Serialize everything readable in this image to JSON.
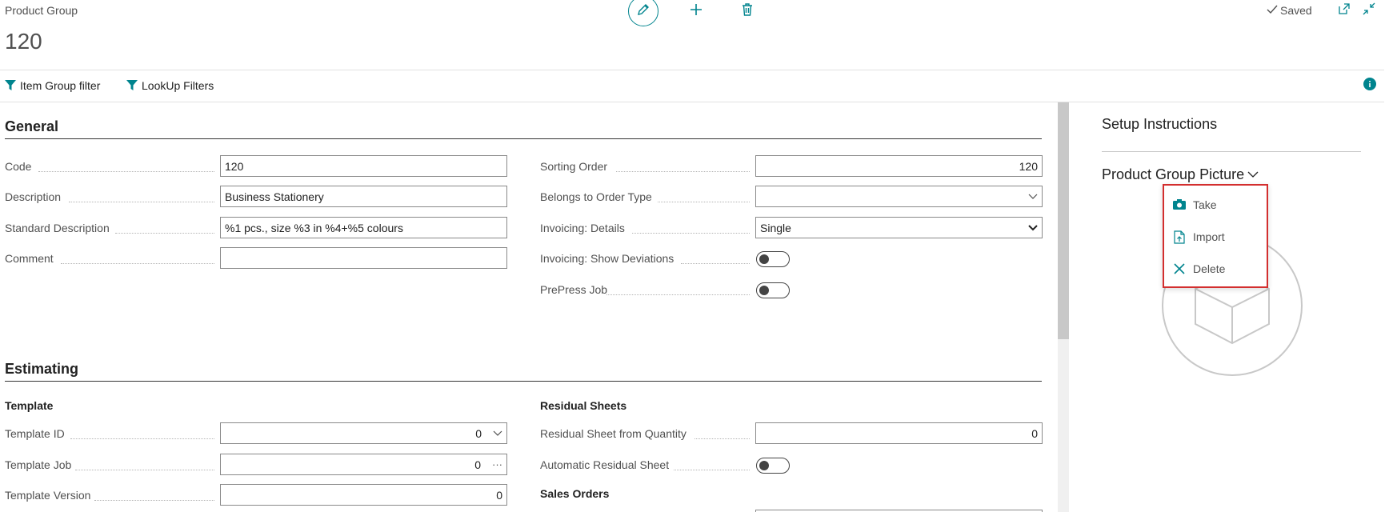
{
  "header": {
    "page_caption": "Product Group",
    "record_title": "120",
    "saved_label": "Saved",
    "icons": [
      "edit-icon",
      "plus-icon",
      "delete-icon",
      "open-new-window-icon",
      "collapse-icon",
      "checkmark-icon"
    ]
  },
  "actions": {
    "item_group_filter": "Item Group filter",
    "lookup_filters": "LookUp Filters"
  },
  "general": {
    "title": "General",
    "code_label": "Code",
    "code_value": "120",
    "description_label": "Description",
    "description_value": "Business Stationery",
    "std_description_label": "Standard Description",
    "std_description_value": "%1 pcs., size %3 in %4+%5 colours",
    "comment_label": "Comment",
    "comment_value": "",
    "sorting_order_label": "Sorting Order",
    "sorting_order_value": "120",
    "belongs_label": "Belongs to Order Type",
    "belongs_value": "",
    "invoicing_details_label": "Invoicing: Details",
    "invoicing_details_value": "Single",
    "invoicing_deviations_label": "Invoicing: Show Deviations",
    "invoicing_deviations_value": false,
    "prepress_label": "PrePress Job",
    "prepress_value": false
  },
  "estimating": {
    "title": "Estimating",
    "template_heading": "Template",
    "template_id_label": "Template ID",
    "template_id_value": "0",
    "template_job_label": "Template Job",
    "template_job_value": "0",
    "template_version_label": "Template Version",
    "template_version_value": "0",
    "residual_heading": "Residual Sheets",
    "residual_qty_label": "Residual Sheet from Quantity",
    "residual_qty_value": "0",
    "auto_residual_label": "Automatic Residual Sheet",
    "auto_residual_value": false,
    "sales_orders_heading": "Sales Orders"
  },
  "factbox": {
    "setup_instructions": "Setup Instructions",
    "picture_title": "Product Group Picture",
    "menu": {
      "take": "Take",
      "import": "Import",
      "delete": "Delete"
    }
  },
  "colors": {
    "accent": "#00848e",
    "menu_border": "#d32f2f"
  }
}
